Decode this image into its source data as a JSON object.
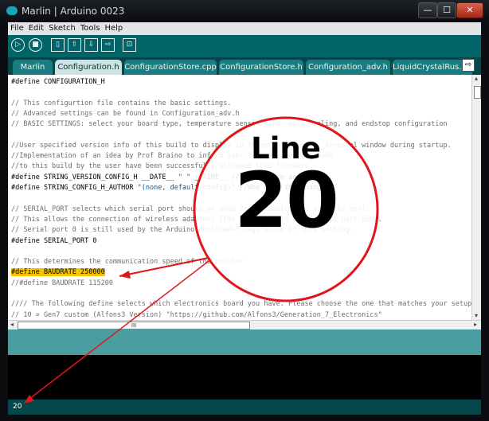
{
  "window": {
    "title": "Marlin | Arduino 0023",
    "buttons": {
      "minimize": "—",
      "maximize": "☐",
      "close": "✕"
    }
  },
  "menu": [
    "File",
    "Edit",
    "Sketch",
    "Tools",
    "Help"
  ],
  "toolbar": {
    "buttons": [
      {
        "name": "verify-button",
        "icon": "play-icon",
        "glyph": "▷"
      },
      {
        "name": "stop-button",
        "icon": "stop-icon",
        "glyph": "■"
      },
      {
        "name": "new-button",
        "icon": "new-file-icon",
        "glyph": "▯"
      },
      {
        "name": "open-button",
        "icon": "open-icon",
        "glyph": "⇧"
      },
      {
        "name": "save-button",
        "icon": "save-icon",
        "glyph": "⇩"
      },
      {
        "name": "upload-button",
        "icon": "upload-icon",
        "glyph": "⇨"
      },
      {
        "name": "serial-monitor-button",
        "icon": "serial-monitor-icon",
        "glyph": "⊡"
      }
    ]
  },
  "tabs": [
    {
      "label": "Marlin",
      "active": false
    },
    {
      "label": "Configuration.h",
      "active": true
    },
    {
      "label": "ConfigurationStore.cpp",
      "active": false
    },
    {
      "label": "ConfigurationStore.h",
      "active": false
    },
    {
      "label": "Configuration_adv.h",
      "active": false
    },
    {
      "label": "LiquidCrystalRus.cpp",
      "active": false
    }
  ],
  "tab_menu_glyph": "⇨",
  "code_lines": [
    {
      "text": "#define CONFIGURATION_H",
      "kind": "dir"
    },
    {
      "text": "",
      "kind": "dir"
    },
    {
      "text": "// This configurtion file contains the basic settings.",
      "kind": "com"
    },
    {
      "text": "// Advanced settings can be found in Configuration_adv.h",
      "kind": "com"
    },
    {
      "text": "// BASIC SETTINGS: select your board type, temperature sensor type, axis scaling, and endstop configuration",
      "kind": "com"
    },
    {
      "text": "",
      "kind": "dir"
    },
    {
      "text": "//User specified version info of this build to display in [Pronterface, etc] terminal window during startup.",
      "kind": "com"
    },
    {
      "text": "//Implementation of an idea by Prof Braino to inform user that any changes made",
      "kind": "com"
    },
    {
      "text": "//to this build by the user have been successfully uploaded into firmware.",
      "kind": "com"
    },
    {
      "text": "#define STRING_VERSION_CONFIG_H __DATE__ \" \" __TIME__ // build date and time",
      "kind": "dir"
    },
    {
      "text": "#define STRING_CONFIG_H_AUTHOR \"(none, default config)\" //Who made the changes.",
      "kind": "dir"
    },
    {
      "text": "",
      "kind": "dir"
    },
    {
      "text": "// SERIAL_PORT selects which serial port should be used for communication with the host.",
      "kind": "com"
    },
    {
      "text": "// This allows the connection of wireless adapters (for instance) to non-default port pins.",
      "kind": "com"
    },
    {
      "text": "// Serial port 0 is still used by the Arduino bootloader regardless of this setting.",
      "kind": "com"
    },
    {
      "text": "#define SERIAL_PORT 0",
      "kind": "dir"
    },
    {
      "text": "",
      "kind": "dir"
    },
    {
      "text": "// This determines the communication speed of the printer",
      "kind": "com"
    },
    {
      "text": "#define BAUDRATE 250000",
      "kind": "dir",
      "highlight": true
    },
    {
      "text": "//#define BAUDRATE 115200",
      "kind": "com"
    },
    {
      "text": "",
      "kind": "dir"
    },
    {
      "text": "//// The following define selects which electronics board you have. Please choose the one that matches your setup",
      "kind": "com"
    },
    {
      "text": "// 10 = Gen7 custom (Alfons3 Version) \"https://github.com/Alfons3/Generation_7_Electronics\"",
      "kind": "com"
    }
  ],
  "scrollbar": {
    "h_thumb_glyph": "III",
    "left_arrow": "◂",
    "right_arrow": "▸",
    "up_arrow": "▴",
    "down_arrow": "▾"
  },
  "status_line": "20",
  "callout": {
    "label_top": "Line",
    "label_number": "20",
    "circle_fill": "#ffffff",
    "stroke_color": "#e0161c"
  },
  "colors": {
    "teal_dark": "#04474b",
    "teal": "#006468",
    "highlight": "#f7c500"
  }
}
